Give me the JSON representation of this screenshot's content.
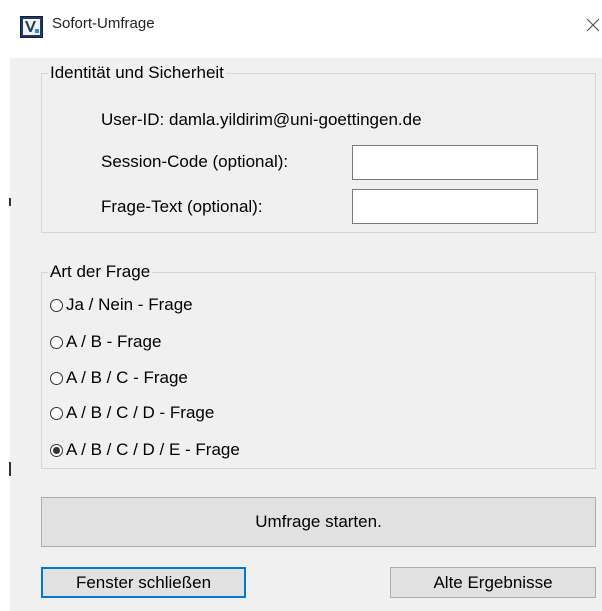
{
  "window": {
    "title": "Sofort-Umfrage"
  },
  "identity": {
    "group_title": "Identität und Sicherheit",
    "user_id_text": "User-ID: damla.yildirim@uni-goettingen.de",
    "session_label": "Session-Code (optional):",
    "session_value": "",
    "question_label": "Frage-Text (optional):",
    "question_value": ""
  },
  "question_type": {
    "group_title": "Art der Frage",
    "options": [
      {
        "label": "Ja / Nein - Frage",
        "checked": false
      },
      {
        "label": "A / B - Frage",
        "checked": false
      },
      {
        "label": "A / B / C - Frage",
        "checked": false
      },
      {
        "label": "A / B / C / D - Frage",
        "checked": false
      },
      {
        "label": "A / B / C / D / E - Frage",
        "checked": true
      }
    ]
  },
  "buttons": {
    "start_label": "Umfrage starten.",
    "close_label": "Fenster schließen",
    "old_results_label": "Alte Ergebnisse"
  },
  "icons": {
    "app": "app-logo-icon",
    "close": "close-icon"
  },
  "colors": {
    "window_bg": "#f0f0f0",
    "accent": "#0078d7",
    "button_bg": "#e1e1e1"
  }
}
